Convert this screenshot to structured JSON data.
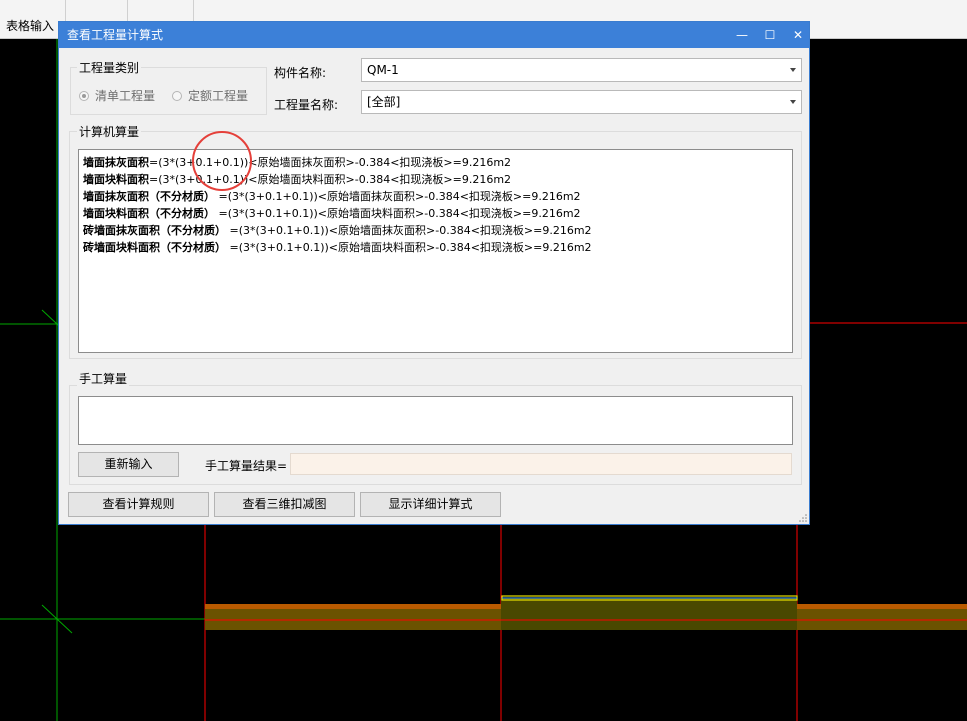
{
  "toolbar": {
    "tab_label": "表格输入"
  },
  "dialog": {
    "title": "查看工程量计算式",
    "controls": {
      "minimize": "—",
      "maximize": "☐",
      "close": "✕"
    },
    "type_group": {
      "label": "工程量类别",
      "options": [
        {
          "label": "清单工程量",
          "selected": true
        },
        {
          "label": "定额工程量",
          "selected": false
        }
      ]
    },
    "component_name": {
      "label": "构件名称:",
      "value": "QM-1"
    },
    "quantity_name": {
      "label": "工程量名称:",
      "value": "[全部]"
    },
    "computer_calc": {
      "label": "计算机算量",
      "lines": [
        {
          "name": "墙面抹灰面积",
          "formula": "=(3*(3+0.1+0.1))<原始墙面抹灰面积>-0.384<扣现浇板>=9.216m2"
        },
        {
          "name": "墙面块料面积",
          "formula": "=(3*(3+0.1+0.1))<原始墙面块料面积>-0.384<扣现浇板>=9.216m2"
        },
        {
          "name": "墙面抹灰面积（不分材质）",
          "formula": " =(3*(3+0.1+0.1))<原始墙面抹灰面积>-0.384<扣现浇板>=9.216m2"
        },
        {
          "name": "墙面块料面积（不分材质）",
          "formula": " =(3*(3+0.1+0.1))<原始墙面块料面积>-0.384<扣现浇板>=9.216m2"
        },
        {
          "name": "砖墙面抹灰面积（不分材质）",
          "formula": " =(3*(3+0.1+0.1))<原始墙面抹灰面积>-0.384<扣现浇板>=9.216m2"
        },
        {
          "name": "砖墙面块料面积（不分材质）",
          "formula": " =(3*(3+0.1+0.1))<原始墙面块料面积>-0.384<扣现浇板>=9.216m2"
        }
      ]
    },
    "manual_calc": {
      "label": "手工算量",
      "reenter_button": "重新输入",
      "result_label": "手工算量结果="
    },
    "buttons": {
      "view_rules": "查看计算规则",
      "view_3d": "查看三维扣减图",
      "show_detail": "显示详细计算式"
    }
  },
  "colors": {
    "title_bar": "#3c80d8",
    "annotation_circle": "#e5403a",
    "cad_wall": "#ff0000",
    "cad_axis": "#00b000"
  }
}
